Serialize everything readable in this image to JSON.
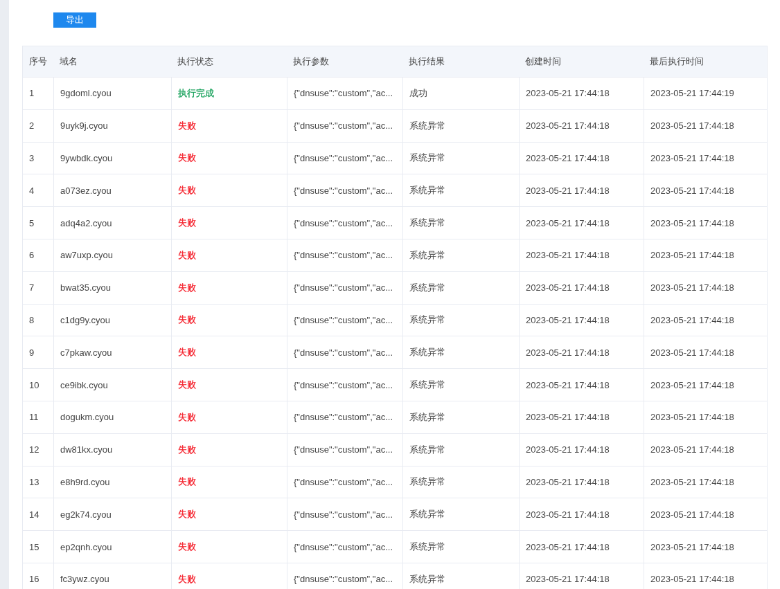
{
  "export_button": "导出",
  "table": {
    "columns": [
      "序号",
      "域名",
      "执行状态",
      "执行参数",
      "执行结果",
      "创建时间",
      "最后执行时间"
    ],
    "rows": [
      {
        "index": "1",
        "domain": "9gdoml.cyou",
        "status": {
          "label": "执行完成",
          "color": "#16a05a"
        },
        "params": "{\"dnsuse\":\"custom\",\"ac...",
        "result": "成功",
        "created": "2023-05-21 17:44:18",
        "last_run": "2023-05-21 17:44:19"
      },
      {
        "index": "2",
        "domain": "9uyk9j.cyou",
        "status": {
          "label": "失败",
          "color": "#f5222d"
        },
        "params": "{\"dnsuse\":\"custom\",\"ac...",
        "result": "系统异常",
        "created": "2023-05-21 17:44:18",
        "last_run": "2023-05-21 17:44:18"
      },
      {
        "index": "3",
        "domain": "9ywbdk.cyou",
        "status": {
          "label": "失败",
          "color": "#f5222d"
        },
        "params": "{\"dnsuse\":\"custom\",\"ac...",
        "result": "系统异常",
        "created": "2023-05-21 17:44:18",
        "last_run": "2023-05-21 17:44:18"
      },
      {
        "index": "4",
        "domain": "a073ez.cyou",
        "status": {
          "label": "失败",
          "color": "#f5222d"
        },
        "params": "{\"dnsuse\":\"custom\",\"ac...",
        "result": "系统异常",
        "created": "2023-05-21 17:44:18",
        "last_run": "2023-05-21 17:44:18"
      },
      {
        "index": "5",
        "domain": "adq4a2.cyou",
        "status": {
          "label": "失败",
          "color": "#f5222d"
        },
        "params": "{\"dnsuse\":\"custom\",\"ac...",
        "result": "系统异常",
        "created": "2023-05-21 17:44:18",
        "last_run": "2023-05-21 17:44:18"
      },
      {
        "index": "6",
        "domain": "aw7uxp.cyou",
        "status": {
          "label": "失败",
          "color": "#f5222d"
        },
        "params": "{\"dnsuse\":\"custom\",\"ac...",
        "result": "系统异常",
        "created": "2023-05-21 17:44:18",
        "last_run": "2023-05-21 17:44:18"
      },
      {
        "index": "7",
        "domain": "bwat35.cyou",
        "status": {
          "label": "失败",
          "color": "#f5222d"
        },
        "params": "{\"dnsuse\":\"custom\",\"ac...",
        "result": "系统异常",
        "created": "2023-05-21 17:44:18",
        "last_run": "2023-05-21 17:44:18"
      },
      {
        "index": "8",
        "domain": "c1dg9y.cyou",
        "status": {
          "label": "失败",
          "color": "#f5222d"
        },
        "params": "{\"dnsuse\":\"custom\",\"ac...",
        "result": "系统异常",
        "created": "2023-05-21 17:44:18",
        "last_run": "2023-05-21 17:44:18"
      },
      {
        "index": "9",
        "domain": "c7pkaw.cyou",
        "status": {
          "label": "失败",
          "color": "#f5222d"
        },
        "params": "{\"dnsuse\":\"custom\",\"ac...",
        "result": "系统异常",
        "created": "2023-05-21 17:44:18",
        "last_run": "2023-05-21 17:44:18"
      },
      {
        "index": "10",
        "domain": "ce9ibk.cyou",
        "status": {
          "label": "失败",
          "color": "#f5222d"
        },
        "params": "{\"dnsuse\":\"custom\",\"ac...",
        "result": "系统异常",
        "created": "2023-05-21 17:44:18",
        "last_run": "2023-05-21 17:44:18"
      },
      {
        "index": "11",
        "domain": "dogukm.cyou",
        "status": {
          "label": "失败",
          "color": "#f5222d"
        },
        "params": "{\"dnsuse\":\"custom\",\"ac...",
        "result": "系统异常",
        "created": "2023-05-21 17:44:18",
        "last_run": "2023-05-21 17:44:18"
      },
      {
        "index": "12",
        "domain": "dw81kx.cyou",
        "status": {
          "label": "失败",
          "color": "#f5222d"
        },
        "params": "{\"dnsuse\":\"custom\",\"ac...",
        "result": "系统异常",
        "created": "2023-05-21 17:44:18",
        "last_run": "2023-05-21 17:44:18"
      },
      {
        "index": "13",
        "domain": "e8h9rd.cyou",
        "status": {
          "label": "失败",
          "color": "#f5222d"
        },
        "params": "{\"dnsuse\":\"custom\",\"ac...",
        "result": "系统异常",
        "created": "2023-05-21 17:44:18",
        "last_run": "2023-05-21 17:44:18"
      },
      {
        "index": "14",
        "domain": "eg2k74.cyou",
        "status": {
          "label": "失败",
          "color": "#f5222d"
        },
        "params": "{\"dnsuse\":\"custom\",\"ac...",
        "result": "系统异常",
        "created": "2023-05-21 17:44:18",
        "last_run": "2023-05-21 17:44:18"
      },
      {
        "index": "15",
        "domain": "ep2qnh.cyou",
        "status": {
          "label": "失败",
          "color": "#f5222d"
        },
        "params": "{\"dnsuse\":\"custom\",\"ac...",
        "result": "系统异常",
        "created": "2023-05-21 17:44:18",
        "last_run": "2023-05-21 17:44:18"
      },
      {
        "index": "16",
        "domain": "fc3ywz.cyou",
        "status": {
          "label": "失败",
          "color": "#f5222d"
        },
        "params": "{\"dnsuse\":\"custom\",\"ac...",
        "result": "系统异常",
        "created": "2023-05-21 17:44:18",
        "last_run": "2023-05-21 17:44:18"
      }
    ]
  }
}
